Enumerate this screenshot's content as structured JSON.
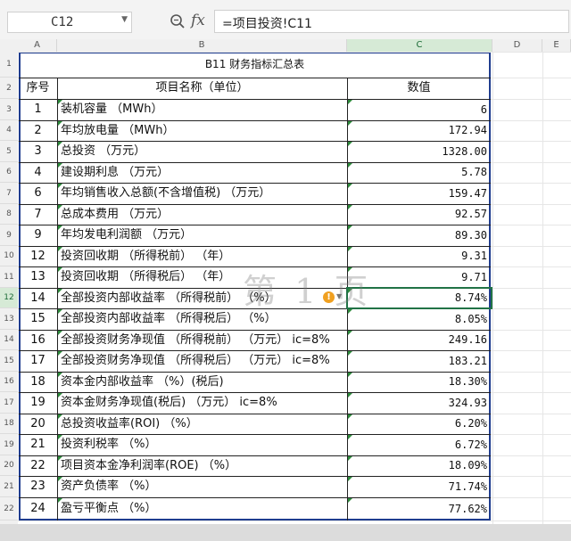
{
  "namebox": {
    "value": "C12"
  },
  "formula": {
    "text": "=项目投资!C11"
  },
  "columns": [
    "A",
    "B",
    "C",
    "D",
    "E"
  ],
  "row_numbers": [
    "1",
    "2",
    "3",
    "4",
    "5",
    "6",
    "7",
    "8",
    "9",
    "10",
    "11",
    "12",
    "13",
    "14",
    "15",
    "16",
    "17",
    "18",
    "19",
    "20",
    "21",
    "22"
  ],
  "table": {
    "title": "B11 财务指标汇总表",
    "headers": {
      "seq": "序号",
      "name": "项目名称（单位）",
      "value": "数值"
    },
    "rows": [
      {
        "seq": "1",
        "name": "装机容量 （MWh）",
        "value": "6"
      },
      {
        "seq": "2",
        "name": "年均放电量 （MWh）",
        "value": "172.94"
      },
      {
        "seq": "3",
        "name": "总投资 （万元）",
        "value": "1328.00"
      },
      {
        "seq": "4",
        "name": "建设期利息 （万元）",
        "value": "5.78"
      },
      {
        "seq": "6",
        "name": "年均销售收入总额(不含增值税) （万元）",
        "value": "159.47"
      },
      {
        "seq": "7",
        "name": "总成本费用 （万元）",
        "value": "92.57"
      },
      {
        "seq": "9",
        "name": "年均发电利润额 （万元）",
        "value": "89.30"
      },
      {
        "seq": "12",
        "name": "投资回收期 （所得税前） （年）",
        "value": "9.31"
      },
      {
        "seq": "13",
        "name": "投资回收期 （所得税后） （年）",
        "value": "9.71"
      },
      {
        "seq": "14",
        "name": "全部投资内部收益率 （所得税前） （%）",
        "value": "8.74%"
      },
      {
        "seq": "15",
        "name": "全部投资内部收益率 （所得税后） （%）",
        "value": "8.05%"
      },
      {
        "seq": "16",
        "name": "全部投资财务净现值 （所得税前） （万元） ic=8%",
        "value": "249.16"
      },
      {
        "seq": "17",
        "name": "全部投资财务净现值 （所得税后） （万元） ic=8%",
        "value": "183.21"
      },
      {
        "seq": "18",
        "name": "资本金内部收益率 （%）(税后)",
        "value": "18.30%"
      },
      {
        "seq": "19",
        "name": "资本金财务净现值(税后) （万元） ic=8%",
        "value": "324.93"
      },
      {
        "seq": "20",
        "name": "总投资收益率(ROI) （%）",
        "value": "6.20%"
      },
      {
        "seq": "21",
        "name": "投资利税率 （%）",
        "value": "6.72%"
      },
      {
        "seq": "22",
        "name": "项目资本金净利润率(ROE) （%）",
        "value": "18.09%"
      },
      {
        "seq": "23",
        "name": "资产负债率 （%）",
        "value": "71.74%"
      },
      {
        "seq": "24",
        "name": "盈亏平衡点 （%）",
        "value": "77.62%"
      }
    ]
  },
  "watermark": {
    "text": "第 1 页"
  },
  "warning": {
    "symbol": "!"
  }
}
